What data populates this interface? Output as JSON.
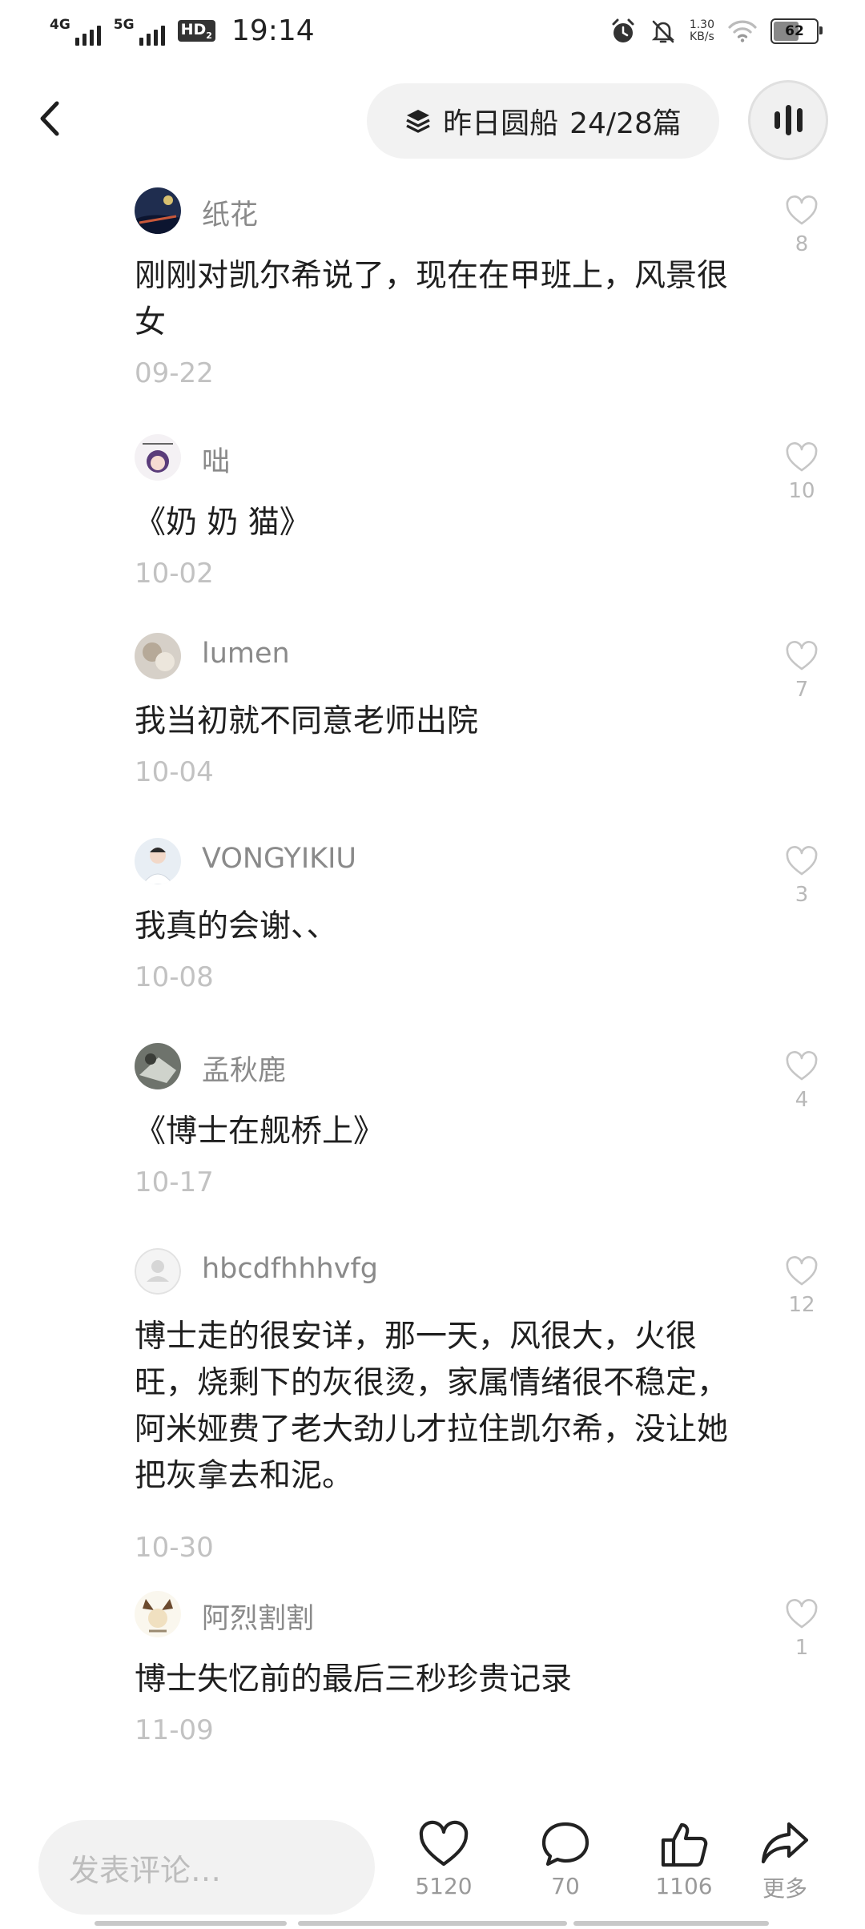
{
  "status_bar": {
    "net1": "4G",
    "net2": "5G",
    "hd_label": "HD",
    "hd_sub": "2",
    "time": "19:14",
    "net_speed": "1.30",
    "net_speed_unit": "KB/s",
    "battery": "62"
  },
  "header": {
    "collection_title": "昨日圆船",
    "progress": "24/28篇"
  },
  "comments": [
    {
      "user": "纸花",
      "text": "刚刚对凯尔希说了，现在在甲班上，风景很女",
      "date": "09-22",
      "likes": "8"
    },
    {
      "user": "咄",
      "text": "《奶 奶 猫》",
      "date": "10-02",
      "likes": "10"
    },
    {
      "user": "lumen",
      "text": "我当初就不同意老师出院",
      "date": "10-04",
      "likes": "7"
    },
    {
      "user": "VONGYIKIU",
      "text": "我真的会谢、、",
      "date": "10-08",
      "likes": "3"
    },
    {
      "user": "孟秋鹿",
      "text": "《博士在舰桥上》",
      "date": "10-17",
      "likes": "4"
    },
    {
      "user": "hbcdfhhhvfg",
      "text": "博士走的很安详，那一天，风很大，火很旺，烧剩下的灰很烫，家属情绪很不稳定，阿米娅费了老大劲儿才拉住凯尔希，没让她把灰拿去和泥。",
      "date": "10-30",
      "likes": "12"
    },
    {
      "user": "阿烈割割",
      "text": "博士失忆前的最后三秒珍贵记录",
      "date": "11-09",
      "likes": "1"
    }
  ],
  "bottom_bar": {
    "input_placeholder": "发表评论…",
    "favorites": "5120",
    "comments": "70",
    "thumbs_up": "1106",
    "more": "更多"
  }
}
